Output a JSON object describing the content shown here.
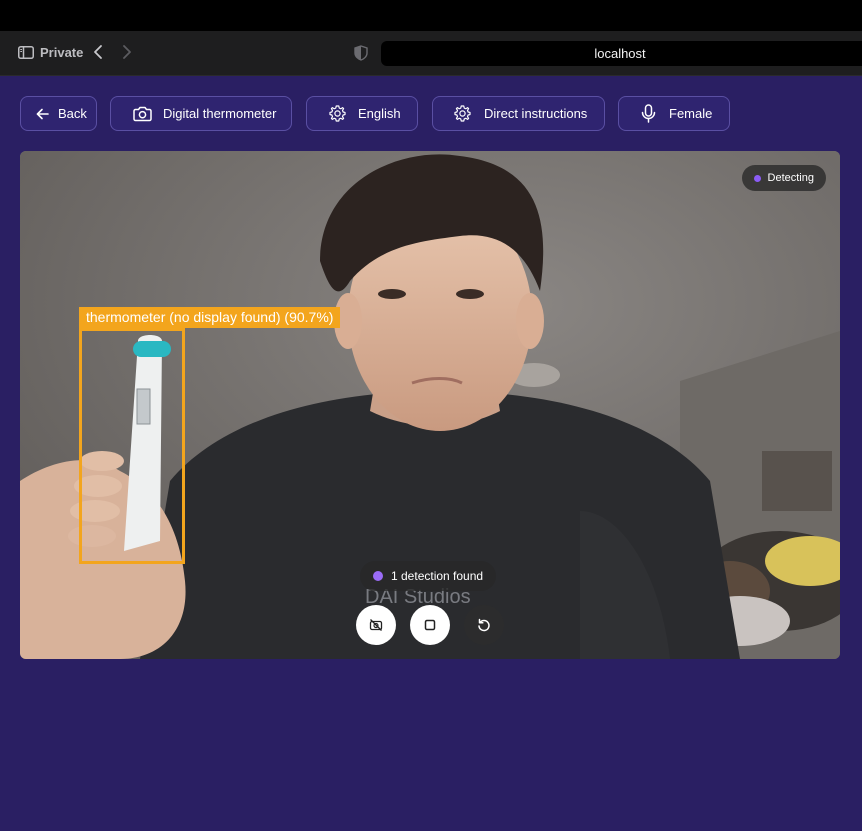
{
  "browser": {
    "private_label": "Private",
    "url": "localhost"
  },
  "toolbar": {
    "back_label": "Back",
    "device_label": "Digital thermometer",
    "language_label": "English",
    "instructions_label": "Direct instructions",
    "voice_label": "Female"
  },
  "video": {
    "status_label": "Detecting",
    "detection_label": "thermometer (no display found) (90.7%)",
    "detections_found_label": "1 detection found"
  },
  "controls": {
    "camera_off_icon": "camera-off-icon",
    "stop_icon": "stop-icon",
    "reset_icon": "rotate-ccw-icon"
  },
  "colors": {
    "page_bg": "#2a1f63",
    "detection_orange": "#f3a51d",
    "status_dot": "#8b5cf6",
    "button_border": "#5a4fa3"
  }
}
